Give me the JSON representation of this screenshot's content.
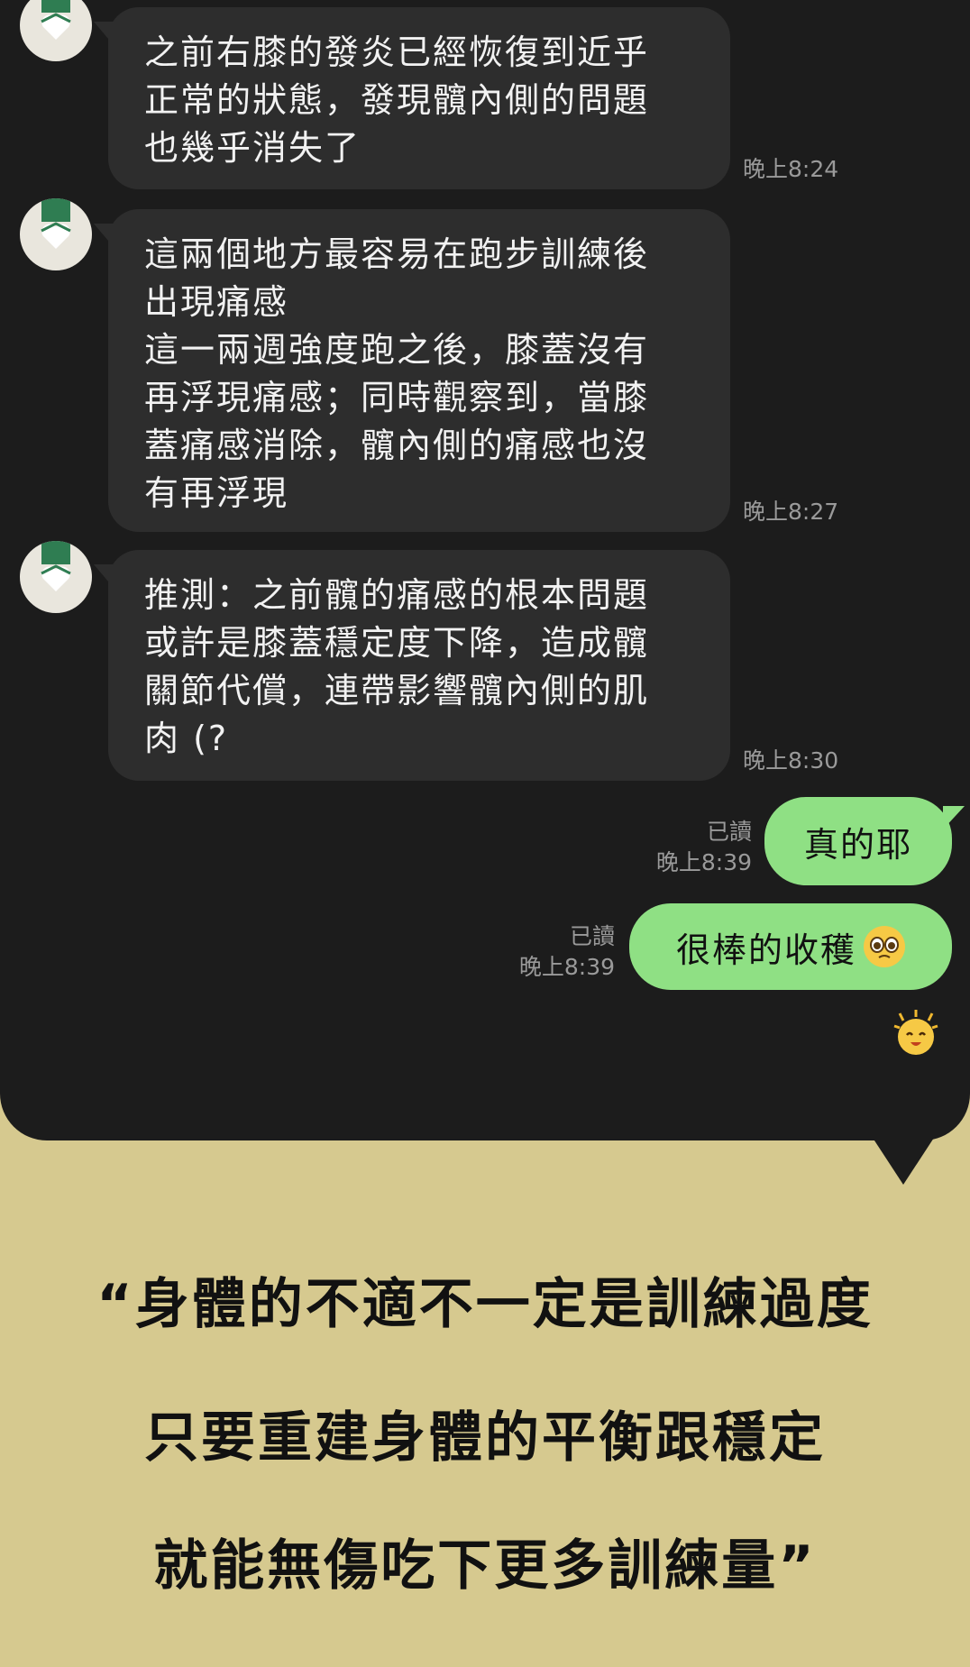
{
  "messages_in": [
    {
      "text": "之前右膝的發炎已經恢復到近乎\n正常的狀態，發現髖內側的問題\n也幾乎消失了",
      "time": "晚上8:24"
    },
    {
      "text": "這兩個地方最容易在跑步訓練後\n出現痛感\n這一兩週強度跑之後，膝蓋沒有\n再浮現痛感；同時觀察到，當膝\n蓋痛感消除，髖內側的痛感也沒\n有再浮現",
      "time": "晚上8:27"
    },
    {
      "text": "推測：之前髖的痛感的根本問題\n或許是膝蓋穩定度下降，造成髖\n關節代償，連帶影響髖內側的肌\n肉 (?",
      "time": "晚上8:30"
    }
  ],
  "messages_out": [
    {
      "text": "真的耶",
      "read": "已讀",
      "time": "晚上8:39"
    },
    {
      "text": "很棒的收穫",
      "read": "已讀",
      "time": "晚上8:39",
      "emoji": "pleading-face"
    }
  ],
  "sticker": "sparkle-face-sticker",
  "quote_lines": [
    "“身體的不適不一定是訓練過度",
    "只要重建身體的平衡跟穩定",
    "就能無傷吃下更多訓練量”"
  ],
  "colors": {
    "chat_bg": "#1c1c1c",
    "page_bg": "#d6c98f",
    "bubble_in": "#2d2d2d",
    "bubble_out": "#8fe084",
    "avatar_cap": "#2f7d52"
  }
}
